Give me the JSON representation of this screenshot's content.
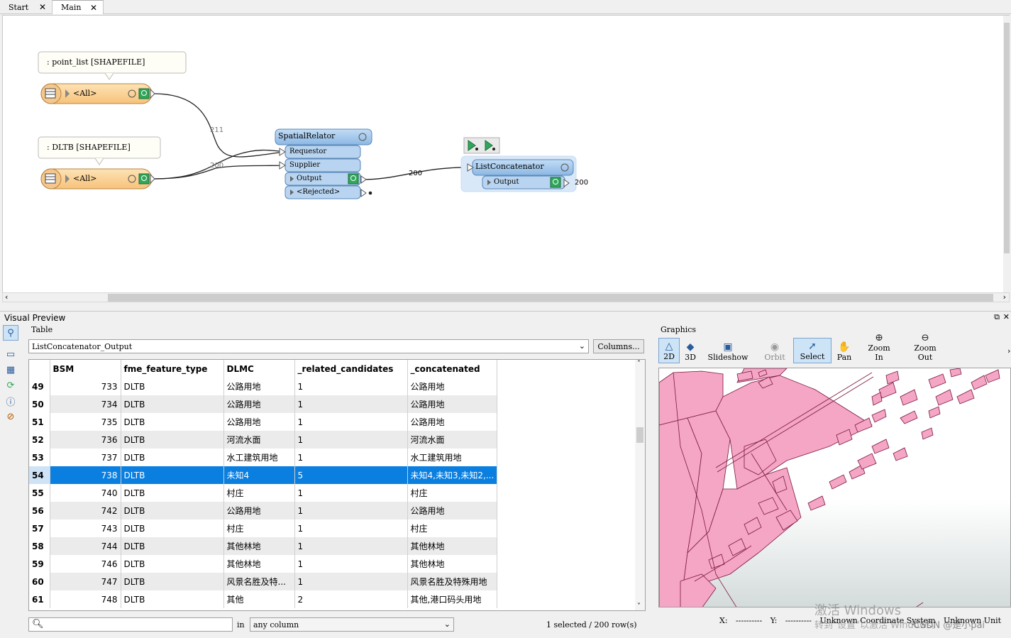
{
  "tabs": [
    {
      "label": "Start"
    },
    {
      "label": "Main"
    }
  ],
  "workspace": {
    "readers": [
      {
        "annotation": ": point_list [SHAPEFILE]",
        "port": "<All>"
      },
      {
        "annotation": ": DLTB [SHAPEFILE]",
        "port": "<All>"
      }
    ],
    "link_counts": {
      "point_list": "211",
      "dltb": "200",
      "spatial_output": "200",
      "concat_output": "200"
    },
    "spatial_relator": {
      "title": "SpatialRelator",
      "inputs": [
        "Requestor",
        "Supplier"
      ],
      "outputs": [
        "Output",
        "<Rejected>"
      ]
    },
    "list_concatenator": {
      "title": "ListConcatenator",
      "outputs": [
        "Output"
      ]
    }
  },
  "visual_preview": {
    "title": "Visual Preview",
    "table_label": "Table",
    "table_name": "ListConcatenator_Output",
    "columns_button": "Columns...",
    "headers": [
      "BSM",
      "fme_feature_type",
      "DLMC",
      "_related_candidates",
      "_concatenated"
    ],
    "rows": [
      {
        "n": "49",
        "bsm": "733",
        "ft": "DLTB",
        "dlmc": "公路用地",
        "rc": "1",
        "cc": "公路用地"
      },
      {
        "n": "50",
        "bsm": "734",
        "ft": "DLTB",
        "dlmc": "公路用地",
        "rc": "1",
        "cc": "公路用地"
      },
      {
        "n": "51",
        "bsm": "735",
        "ft": "DLTB",
        "dlmc": "公路用地",
        "rc": "1",
        "cc": "公路用地"
      },
      {
        "n": "52",
        "bsm": "736",
        "ft": "DLTB",
        "dlmc": "河流水面",
        "rc": "1",
        "cc": "河流水面"
      },
      {
        "n": "53",
        "bsm": "737",
        "ft": "DLTB",
        "dlmc": "水工建筑用地",
        "rc": "1",
        "cc": "水工建筑用地"
      },
      {
        "n": "54",
        "bsm": "738",
        "ft": "DLTB",
        "dlmc": "未知4",
        "rc": "5",
        "cc": "未知4,未知3,未知2,...",
        "selected": true
      },
      {
        "n": "55",
        "bsm": "740",
        "ft": "DLTB",
        "dlmc": "村庄",
        "rc": "1",
        "cc": "村庄"
      },
      {
        "n": "56",
        "bsm": "742",
        "ft": "DLTB",
        "dlmc": "公路用地",
        "rc": "1",
        "cc": "公路用地"
      },
      {
        "n": "57",
        "bsm": "743",
        "ft": "DLTB",
        "dlmc": "村庄",
        "rc": "1",
        "cc": "村庄"
      },
      {
        "n": "58",
        "bsm": "744",
        "ft": "DLTB",
        "dlmc": "其他林地",
        "rc": "1",
        "cc": "其他林地"
      },
      {
        "n": "59",
        "bsm": "746",
        "ft": "DLTB",
        "dlmc": "其他林地",
        "rc": "1",
        "cc": "其他林地"
      },
      {
        "n": "60",
        "bsm": "747",
        "ft": "DLTB",
        "dlmc": "风景名胜及特...",
        "rc": "1",
        "cc": "风景名胜及特殊用地"
      },
      {
        "n": "61",
        "bsm": "748",
        "ft": "DLTB",
        "dlmc": "其他",
        "rc": "2",
        "cc": "其他,港口码头用地"
      }
    ],
    "search_in_label": "in",
    "search_column": "any column",
    "status": "1 selected / 200 row(s)"
  },
  "graphics": {
    "label": "Graphics",
    "tools": [
      {
        "label": "2D",
        "icon": "2d-shapes-icon",
        "selected": true
      },
      {
        "label": "3D",
        "icon": "3d-shapes-icon"
      },
      {
        "label": "Slideshow",
        "icon": "slideshow-icon"
      },
      {
        "label": "Orbit",
        "icon": "orbit-icon",
        "disabled": true
      },
      {
        "label": "Select",
        "icon": "select-cursor-icon",
        "selected": true
      },
      {
        "label": "Pan",
        "icon": "hand-icon"
      },
      {
        "label": "Zoom In",
        "icon": "zoom-in-icon"
      },
      {
        "label": "Zoom Out",
        "icon": "zoom-out-icon"
      }
    ],
    "x_label": "X:",
    "x_value": "----------",
    "y_label": "Y:",
    "y_value": "----------",
    "coord_system": "Unknown Coordinate System",
    "units": "Unknown Unit"
  },
  "watermark": {
    "line1": "激活 Windows",
    "line2": "转到\"设置\"以激活 Windows。",
    "credit": "CSDN @是小pai"
  },
  "colors": {
    "reader_orange": "#fbd49a",
    "transformer_blue": "#a4c8ea",
    "selection_blue": "#0a7fe0",
    "polygon_pink": "#f5a6c4"
  }
}
